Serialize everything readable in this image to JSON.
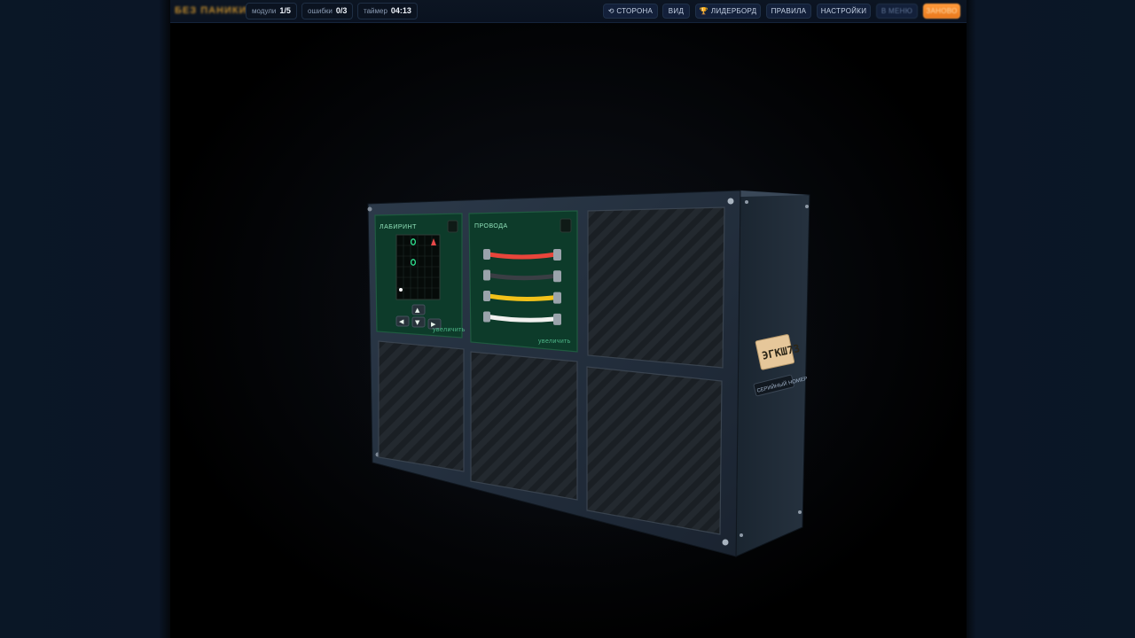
{
  "topbar": {
    "logo": "БЕЗ ПАНИКИ",
    "stats": {
      "modules_label": "модули",
      "modules_value": "1/5",
      "errors_label": "ошибки",
      "errors_value": "0/3",
      "timer_label": "таймер",
      "timer_value": "04:13"
    },
    "nav": {
      "side": "⟲ СТОРОНА",
      "view": "ВИД",
      "leaderboard": "ЛИДЕРБОРД",
      "rules": "ПРАВИЛА",
      "settings": "НАСТРОЙКИ",
      "menu": "В МЕНЮ",
      "action": "ЗАНОВО"
    }
  },
  "bomb": {
    "maze_module": {
      "title": "ЛАБИРИНТ",
      "zoom": "увеличить",
      "arrows": {
        "up": "▲",
        "down": "▼",
        "left": "◀",
        "right": "▶"
      }
    },
    "wires_module": {
      "title": "ПРОВОДА",
      "zoom": "увеличить",
      "wire_colors": [
        "#e8453b",
        "#3a3e44",
        "#f2c21a",
        "#f1f1ef"
      ]
    },
    "serial": {
      "number": "ЭГКШ73",
      "caption": "СЕРИЙНЫЙ НОМЕР"
    }
  },
  "colors": {
    "module_green": "#0d3b2a",
    "maze_marker": "#2fe08f",
    "maze_target": "#e84848",
    "accent_orange": "#ff9a3a"
  }
}
